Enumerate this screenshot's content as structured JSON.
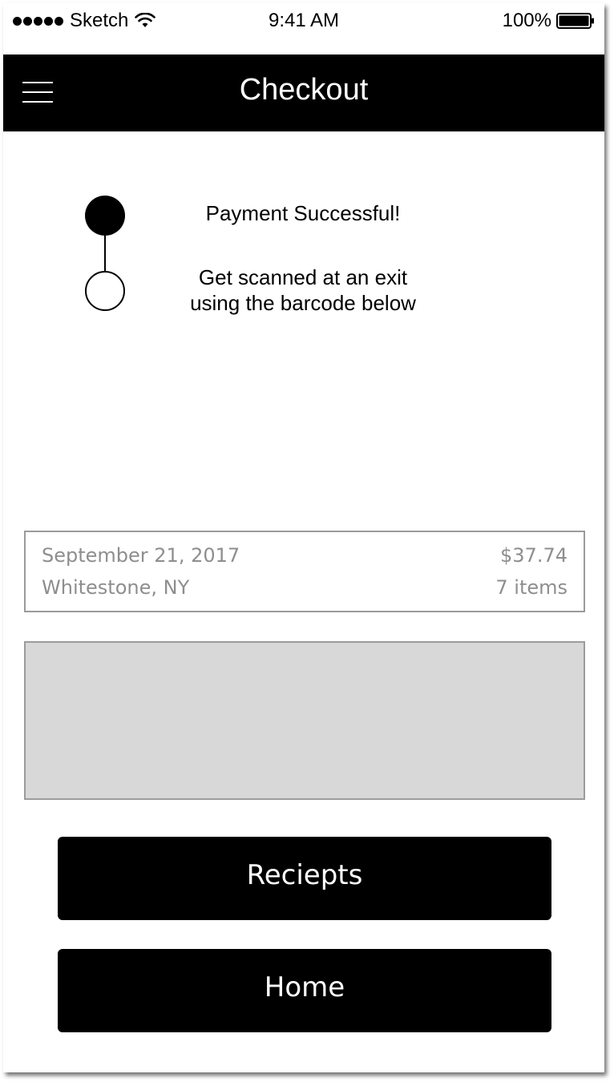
{
  "status_bar": {
    "carrier": "Sketch",
    "time": "9:41 AM",
    "battery": "100%",
    "icons": [
      "signal-dots-icon",
      "wifi-icon",
      "battery-icon"
    ]
  },
  "nav": {
    "title": "Checkout",
    "menu_icon": "hamburger-menu-icon"
  },
  "steps": {
    "step1": "Payment Successful!",
    "step2_line1": "Get scanned at an exit",
    "step2_line2": "using the barcode below",
    "completed_steps": 1,
    "total_steps": 2
  },
  "summary": {
    "date": "September 21, 2017",
    "location": "Whitestone, NY",
    "total": "$37.74",
    "items": "7 items"
  },
  "buttons": {
    "receipts": "Reciepts",
    "home": "Home"
  },
  "colors": {
    "nav_background": "#000000",
    "button_background": "#000000",
    "summary_text": "#8e8e8e",
    "barcode_placeholder": "#d8d8d8"
  }
}
